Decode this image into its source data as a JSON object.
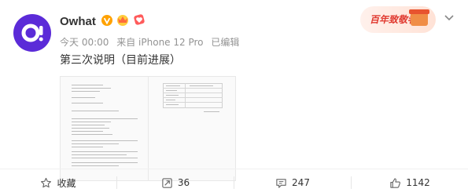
{
  "post": {
    "author": "Owhat",
    "time": "今天 00:00",
    "source": "来自 iPhone 12 Pro",
    "edited": "已编辑",
    "text": "第三次说明（目前进展）"
  },
  "promo": {
    "text": "百年致敬者"
  },
  "actions": {
    "favorite": "收藏",
    "repost": "36",
    "comment": "247",
    "like": "1142"
  },
  "colors": {
    "avatar": "#5b2bd8",
    "verified": "#ffa200",
    "promo": "#e0392f"
  },
  "icons": [
    "verified-icon",
    "crown-badge-icon",
    "heart-badge-icon",
    "chevron-down-icon",
    "star-icon",
    "repost-icon",
    "comment-icon",
    "like-icon"
  ]
}
